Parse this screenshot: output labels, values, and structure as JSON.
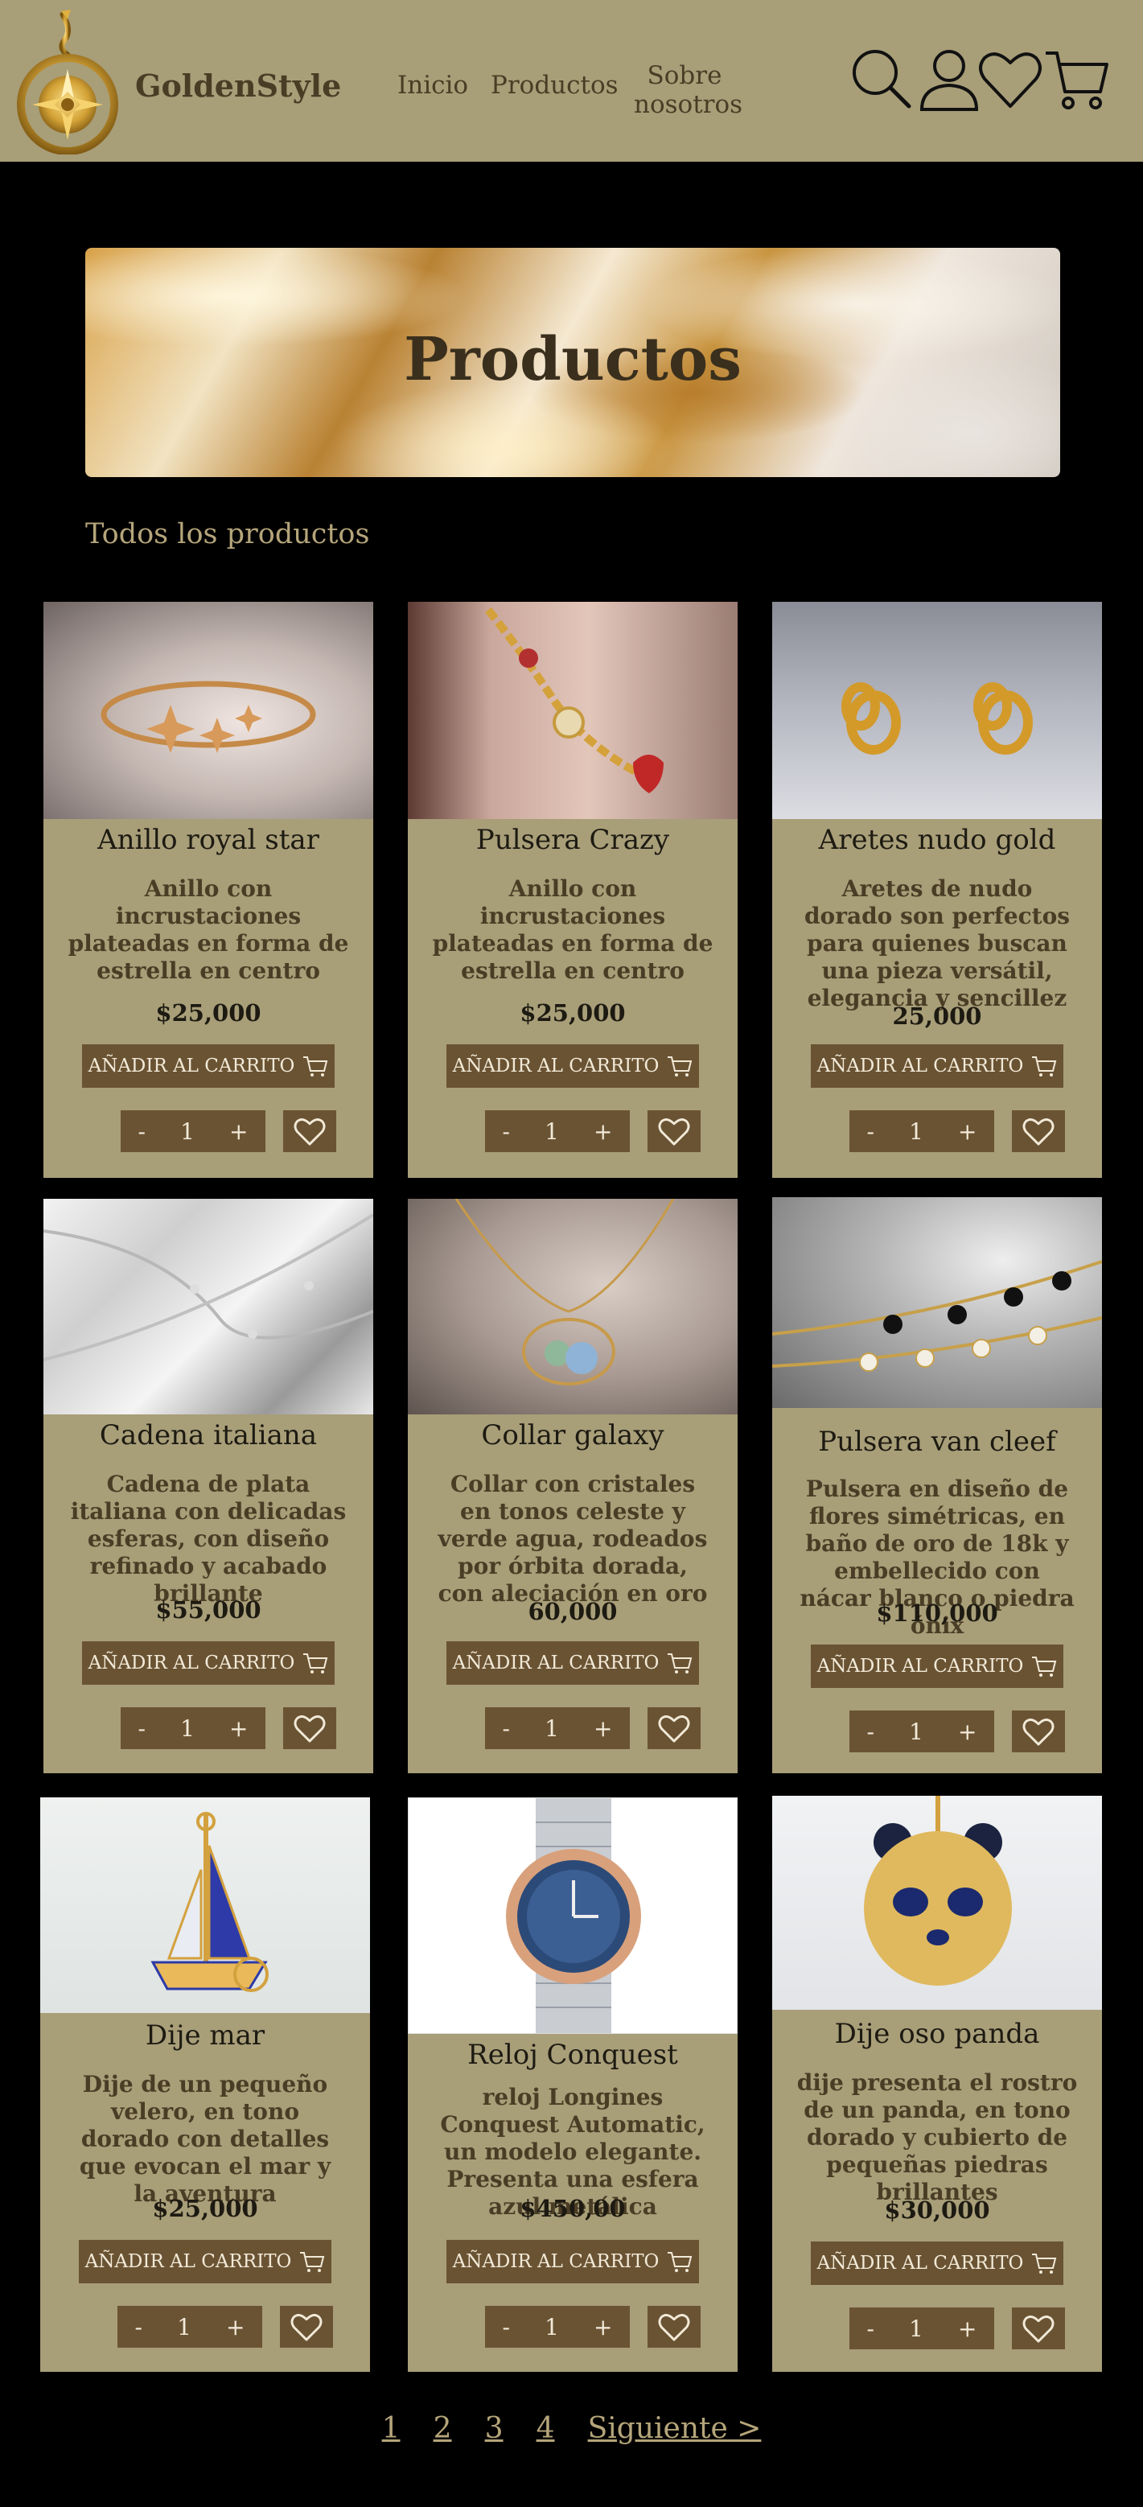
{
  "brand": {
    "name": "GoldenStyle",
    "logo_icon": "compass-snake-logo"
  },
  "nav": {
    "inicio": "Inicio",
    "productos": "Productos",
    "sobre": "Sobre nosotros"
  },
  "header_icons": [
    "search-icon",
    "user-icon",
    "heart-icon",
    "cart-icon"
  ],
  "banner": {
    "title": "Productos"
  },
  "section_title": "Todos los productos",
  "add_label": "AÑADIR AL CARRITO",
  "stepper": {
    "minus": "-",
    "qty": "1",
    "plus": "+"
  },
  "colors": {
    "header": "#a89e78",
    "button": "#6a5333",
    "title_text": "#4a3d25",
    "accent_text": "#b5a57a"
  },
  "products": [
    {
      "title": "Anillo royal star",
      "description": "Anillo con incrustaciones plateadas en forma de estrella en centro",
      "price": "$25,000"
    },
    {
      "title": "Pulsera Crazy",
      "description": "Anillo con incrustaciones plateadas en forma de estrella en centro",
      "price": "$25,000"
    },
    {
      "title": "Aretes nudo gold",
      "description": "Aretes de nudo dorado son perfectos para quienes buscan una pieza versátil, elegancia y sencillez",
      "price": "25,000"
    },
    {
      "title": "Cadena italiana",
      "description": "Cadena de plata italiana con delicadas esferas, con diseño refinado y acabado brillante",
      "price": "$55,000"
    },
    {
      "title": "Collar galaxy",
      "description": "Collar con cristales en tonos celeste y verde agua, rodeados por órbita dorada, con aleciación en oro",
      "price": "60,000"
    },
    {
      "title": "Pulsera van cleef",
      "description": "Pulsera en diseño de flores simétricas, en baño de oro de 18k y embellecido con nácar blanco o piedra ónix",
      "price": "$110,000"
    },
    {
      "title": "Dije mar",
      "description": "Dije de un pequeño velero, en tono dorado con detalles que evocan el mar y la aventura",
      "price": "$25,000"
    },
    {
      "title": "Reloj Conquest",
      "description": "reloj Longines Conquest Automatic, un modelo elegante. Presenta una esfera azul metálica",
      "price": "$450,00"
    },
    {
      "title": "Dije oso panda",
      "description": "dije presenta el rostro de un panda, en tono dorado y cubierto de pequeñas piedras brillantes",
      "price": "$30,000"
    }
  ],
  "pagination": {
    "p1": "1",
    "p2": "2",
    "p3": "3",
    "p4": "4",
    "next": "Siguiente >"
  }
}
